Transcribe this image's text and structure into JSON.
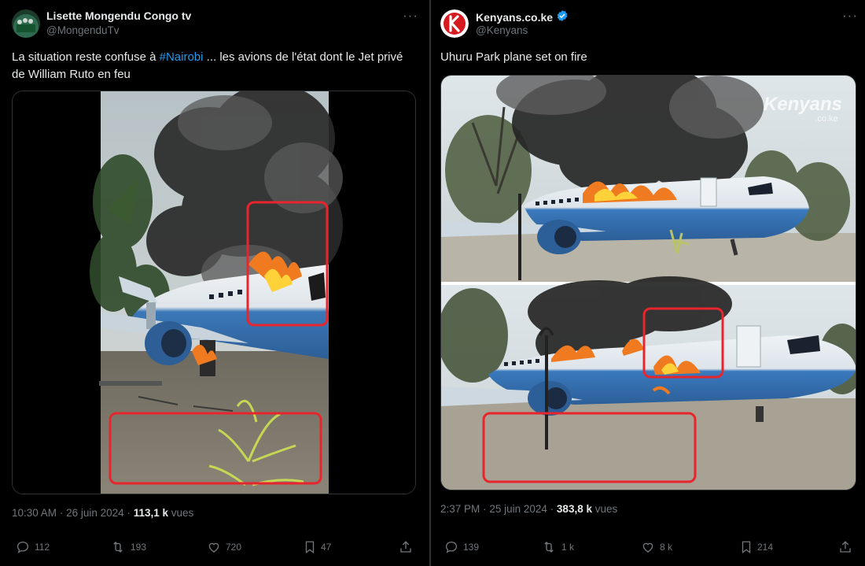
{
  "tweets": [
    {
      "author_name": "Lisette Mongendu Congo tv",
      "handle": "@MongenduTv",
      "text_before": "La situation reste confuse à ",
      "hashtag": "#Nairobi",
      "text_after": "  ... les avions de l'état dont le Jet privé de William Ruto en feu",
      "time": "10:30 AM",
      "date": "26 juin 2024",
      "views_count": "113,1 k",
      "views_label": "vues",
      "actions": {
        "replies": "112",
        "reposts": "193",
        "likes": "720",
        "bookmarks": "47"
      }
    },
    {
      "author_name": "Kenyans.co.ke",
      "handle": "@Kenyans",
      "verified": true,
      "text": "Uhuru Park plane set on fire",
      "watermark_line1": "Kenyans",
      "watermark_line2": ".co.ke",
      "time": "2:37 PM",
      "date": "25 juin 2024",
      "views_count": "383,8 k",
      "views_label": "vues",
      "actions": {
        "replies": "139",
        "reposts": "1 k",
        "likes": "8 k",
        "bookmarks": "214"
      }
    }
  ],
  "separator": "·",
  "colors": {
    "background": "#000000",
    "text": "#e7e9ea",
    "muted": "#71767b",
    "link": "#1d9bf0",
    "annotation": "#e8252c",
    "verified": "#1d9bf0"
  }
}
